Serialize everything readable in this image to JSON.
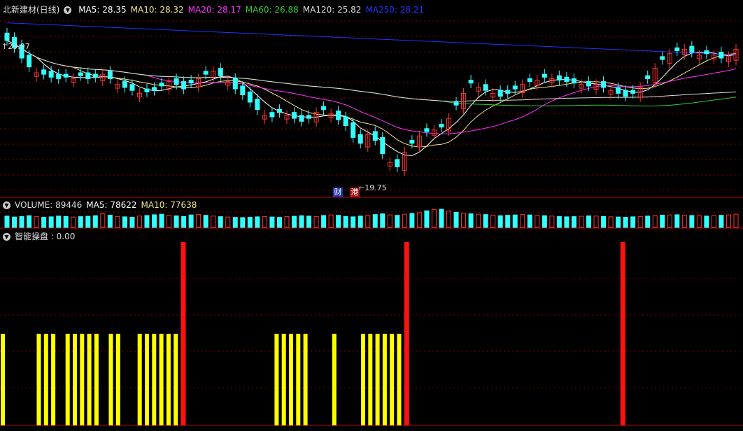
{
  "main": {
    "stock_title": "北新建材(日线)",
    "ma": [
      {
        "label": "MA5:",
        "value": "28.35",
        "color": "#ffffff"
      },
      {
        "label": "MA10:",
        "value": "28.32",
        "color": "#f0e68c"
      },
      {
        "label": "MA20:",
        "value": "28.17",
        "color": "#ff33ff"
      },
      {
        "label": "MA60:",
        "value": "26.88",
        "color": "#33cc33"
      },
      {
        "label": "MA120:",
        "value": "25.82",
        "color": "#dddddd"
      },
      {
        "label": "MA250:",
        "value": "28.21",
        "color": "#2233ff"
      }
    ],
    "high_label": "29.97",
    "low_label": "19.75",
    "badge_cai": "财",
    "badge_gang": "港"
  },
  "volume": {
    "label": "VOLUME: 89446",
    "ma5": "MA5: 78622",
    "ma10": "MA10: 77638"
  },
  "indicator": {
    "label": "智能操盘 : 0.00"
  },
  "colors": {
    "up": "#ff3333",
    "down": "#33ffff",
    "signal_yellow": "#ffff00",
    "signal_red": "#ff1111",
    "grid": "#8b0000"
  },
  "chart_data": [
    {
      "type": "candlestick",
      "title": "北新建材(日线)",
      "ylim": [
        19.0,
        31.0
      ],
      "close": [
        29.2,
        28.7,
        28.0,
        27.4,
        27.0,
        26.9,
        26.7,
        26.6,
        26.7,
        26.6,
        26.8,
        26.6,
        26.7,
        26.9,
        26.6,
        26.2,
        26.0,
        25.8,
        25.6,
        25.7,
        25.8,
        26.1,
        26.4,
        26.2,
        25.9,
        26.3,
        26.6,
        26.9,
        27.1,
        26.8,
        26.4,
        25.9,
        25.5,
        25.0,
        24.5,
        24.1,
        24.0,
        24.3,
        24.1,
        23.9,
        23.7,
        23.9,
        24.3,
        24.5,
        24.2,
        23.8,
        23.4,
        22.6,
        22.2,
        22.8,
        22.4,
        21.5,
        20.9,
        20.6,
        21.6,
        22.2,
        22.7,
        23.0,
        23.1,
        23.3,
        23.9,
        24.8,
        25.6,
        26.3,
        26.0,
        25.8,
        25.6,
        25.4,
        25.6,
        25.9,
        26.2,
        26.4,
        26.5,
        26.7,
        26.6,
        26.5,
        26.4,
        26.3,
        26.2,
        26.1,
        26.2,
        26.0,
        25.8,
        25.6,
        25.4,
        25.6,
        26.0,
        26.6,
        27.3,
        27.9,
        28.3,
        28.5,
        28.6,
        28.4,
        28.2,
        28.3,
        28.2,
        28.0,
        28.1,
        28.6
      ],
      "up_days": [
        4,
        9,
        13,
        15,
        18,
        22,
        26,
        28,
        30,
        35,
        38,
        42,
        44,
        49,
        52,
        54,
        56,
        58,
        60,
        62,
        64,
        66,
        70,
        72,
        74,
        78,
        80,
        82,
        86,
        88,
        90,
        92,
        94,
        96,
        98,
        99
      ],
      "low_point": 19.75,
      "high_point": 29.97
    },
    {
      "type": "bar",
      "title": "VOLUME",
      "values": [
        60,
        55,
        58,
        62,
        57,
        54,
        56,
        60,
        58,
        55,
        57,
        59,
        62,
        72,
        65,
        58,
        56,
        54,
        60,
        63,
        67,
        70,
        64,
        61,
        58,
        66,
        69,
        64,
        60,
        57,
        55,
        53,
        52,
        54,
        56,
        58,
        55,
        53,
        57,
        59,
        62,
        60,
        58,
        63,
        66,
        64,
        58,
        56,
        60,
        62,
        68,
        72,
        66,
        64,
        70,
        74,
        78,
        88,
        95,
        96,
        86,
        80,
        75,
        72,
        70,
        68,
        65,
        62,
        64,
        66,
        68,
        66,
        64,
        62,
        60,
        58,
        56,
        57,
        59,
        61,
        60,
        58,
        56,
        55,
        54,
        56,
        58,
        60,
        63,
        65,
        66,
        67,
        65,
        63,
        62,
        60,
        62,
        64,
        66,
        70
      ]
    },
    {
      "type": "bar",
      "title": "智能操盘",
      "signals": [
        {
          "index": 0,
          "level": "low"
        },
        {
          "index": 5,
          "level": "low"
        },
        {
          "index": 6,
          "level": "low"
        },
        {
          "index": 7,
          "level": "low"
        },
        {
          "index": 9,
          "level": "low"
        },
        {
          "index": 10,
          "level": "low"
        },
        {
          "index": 11,
          "level": "low"
        },
        {
          "index": 12,
          "level": "low"
        },
        {
          "index": 13,
          "level": "low"
        },
        {
          "index": 15,
          "level": "low"
        },
        {
          "index": 16,
          "level": "low"
        },
        {
          "index": 19,
          "level": "low"
        },
        {
          "index": 20,
          "level": "low"
        },
        {
          "index": 21,
          "level": "low"
        },
        {
          "index": 22,
          "level": "low"
        },
        {
          "index": 23,
          "level": "low"
        },
        {
          "index": 24,
          "level": "low"
        },
        {
          "index": 25,
          "level": "high"
        },
        {
          "index": 38,
          "level": "low"
        },
        {
          "index": 39,
          "level": "low"
        },
        {
          "index": 40,
          "level": "low"
        },
        {
          "index": 41,
          "level": "low"
        },
        {
          "index": 42,
          "level": "low"
        },
        {
          "index": 46,
          "level": "low"
        },
        {
          "index": 50,
          "level": "low"
        },
        {
          "index": 51,
          "level": "low"
        },
        {
          "index": 52,
          "level": "low"
        },
        {
          "index": 53,
          "level": "low"
        },
        {
          "index": 54,
          "level": "low"
        },
        {
          "index": 55,
          "level": "low"
        },
        {
          "index": 56,
          "level": "high"
        },
        {
          "index": 86,
          "level": "high"
        }
      ]
    }
  ]
}
